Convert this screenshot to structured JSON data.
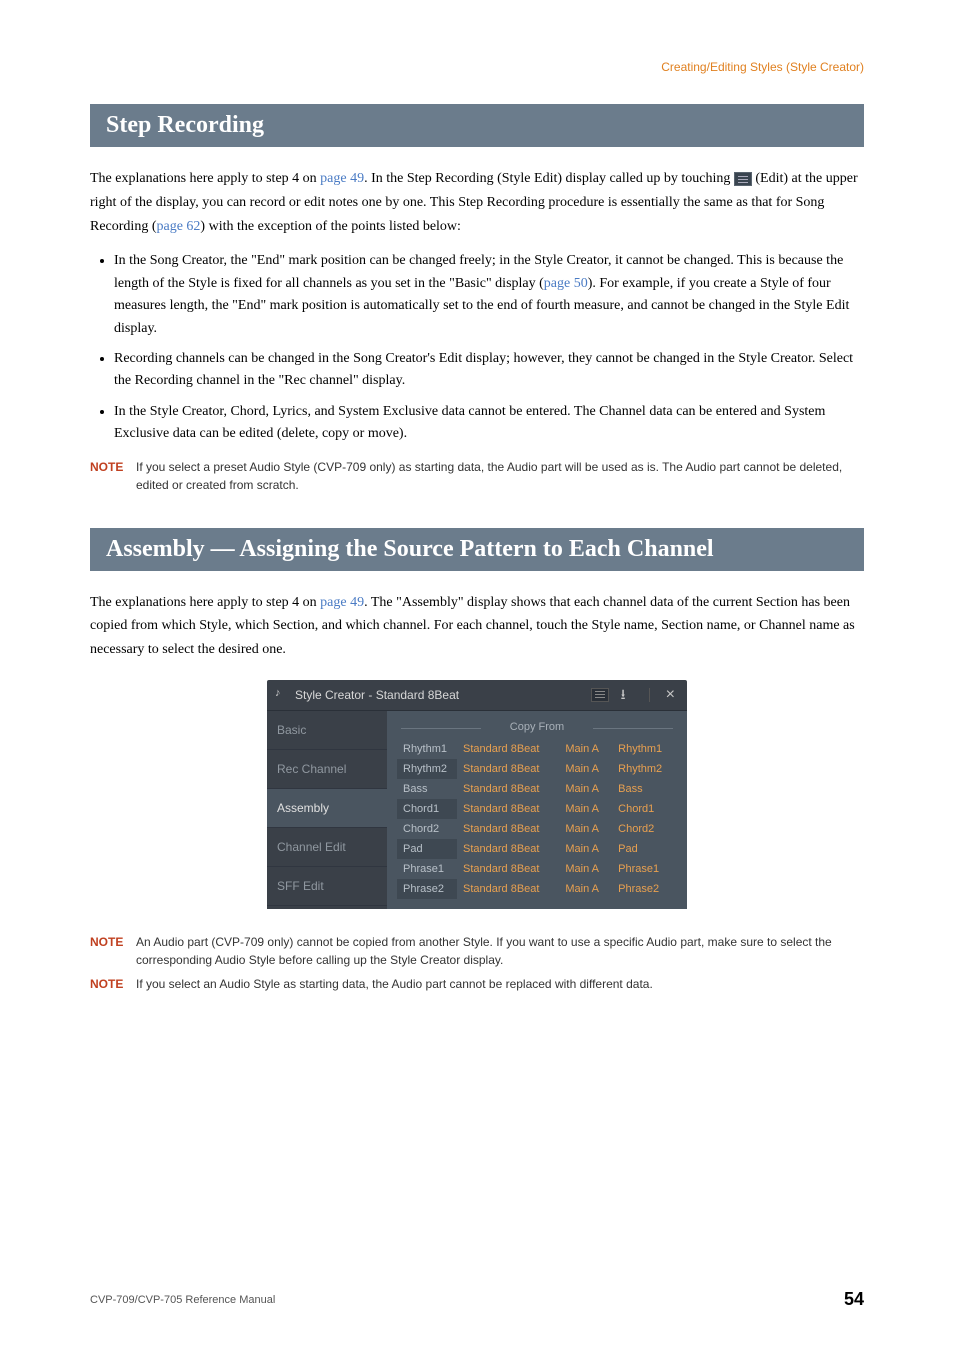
{
  "breadcrumb": "Creating/Editing Styles (Style Creator)",
  "section1": {
    "title": "Step Recording",
    "para1_a": "The explanations here apply to step 4 on ",
    "para1_link1": "page 49",
    "para1_b": ". In the Step Recording (Style Edit) display called up by touching ",
    "para1_c": " (Edit) at the upper right of the display, you can record or edit notes one by one. This Step Recording procedure is essentially the same as that for Song Recording (",
    "para1_link2": "page 62",
    "para1_d": ") with the exception of the points listed below:",
    "bullets": [
      {
        "a": "In the Song Creator, the \"End\" mark position can be changed freely; in the Style Creator, it cannot be changed. This is because the length of the Style is fixed for all channels as you set in the \"Basic\" display (",
        "link": "page 50",
        "b": "). For example, if you create a Style of four measures length, the \"End\" mark position is automatically set to the end of fourth measure, and cannot be changed in the Style Edit display."
      },
      {
        "a": "Recording channels can be changed in the Song Creator's Edit display; however, they cannot be changed in the Style Creator. Select the Recording channel in the \"Rec channel\" display.",
        "link": "",
        "b": ""
      },
      {
        "a": "In the Style Creator, Chord, Lyrics, and System Exclusive data cannot be entered. The Channel data can be entered and System Exclusive data can be edited (delete, copy or move).",
        "link": "",
        "b": ""
      }
    ],
    "note_label": "NOTE",
    "note1": "If you select a preset Audio Style (CVP-709 only) as starting data, the Audio part will be used as is. The Audio part cannot be deleted, edited or created from scratch."
  },
  "section2": {
    "title": "Assembly — Assigning the Source Pattern to Each Channel",
    "para1_a": "The explanations here apply to step 4 on ",
    "para1_link1": "page 49",
    "para1_b": ". The \"Assembly\" display shows that each channel data of the current Section has been copied from which Style, which Section, and which channel. For each channel, touch the Style name, Section name, or Channel name as necessary to select the desired one.",
    "note_label": "NOTE",
    "note1": "An Audio part (CVP-709 only) cannot be copied from another Style. If you want to use a specific Audio part, make sure to select the corresponding Audio Style before calling up the Style Creator display.",
    "note2": "If you select an Audio Style as starting data, the Audio part cannot be replaced with different data."
  },
  "screenshot": {
    "title": "Style Creator - Standard 8Beat",
    "save_glyph": "⭳",
    "close_glyph": "×",
    "tabs": [
      "Basic",
      "Rec Channel",
      "Assembly",
      "Channel Edit",
      "SFF Edit"
    ],
    "active_tab_index": 2,
    "copy_from": "Copy From",
    "rows": [
      {
        "chan": "Rhythm1",
        "style": "Standard 8Beat",
        "section": "Main A",
        "src": "Rhythm1"
      },
      {
        "chan": "Rhythm2",
        "style": "Standard 8Beat",
        "section": "Main A",
        "src": "Rhythm2"
      },
      {
        "chan": "Bass",
        "style": "Standard 8Beat",
        "section": "Main A",
        "src": "Bass"
      },
      {
        "chan": "Chord1",
        "style": "Standard 8Beat",
        "section": "Main A",
        "src": "Chord1"
      },
      {
        "chan": "Chord2",
        "style": "Standard 8Beat",
        "section": "Main A",
        "src": "Chord2"
      },
      {
        "chan": "Pad",
        "style": "Standard 8Beat",
        "section": "Main A",
        "src": "Pad"
      },
      {
        "chan": "Phrase1",
        "style": "Standard 8Beat",
        "section": "Main A",
        "src": "Phrase1"
      },
      {
        "chan": "Phrase2",
        "style": "Standard 8Beat",
        "section": "Main A",
        "src": "Phrase2"
      }
    ]
  },
  "footer": {
    "left": "CVP-709/CVP-705 Reference Manual",
    "page": "54"
  }
}
